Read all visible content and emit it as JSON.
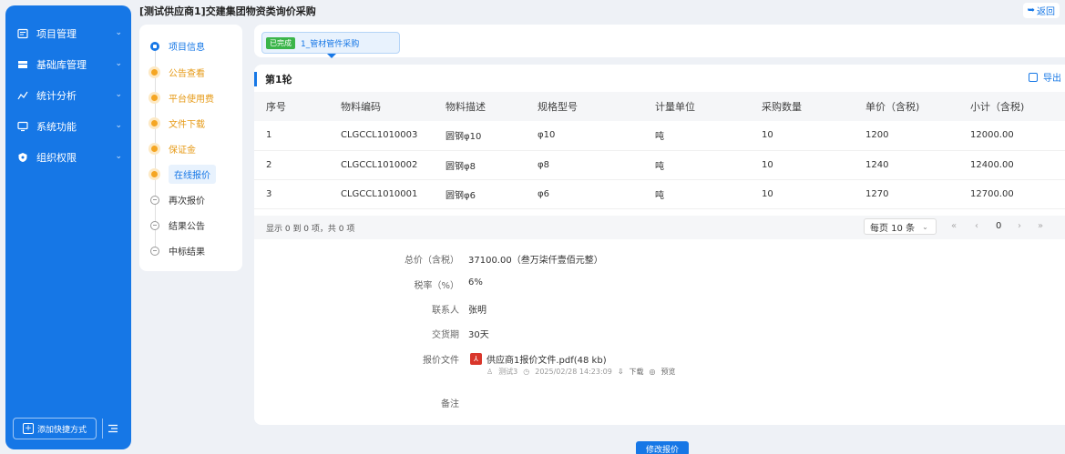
{
  "page": {
    "title": "[测试供应商1]交建集团物资类询价采购",
    "back_label": "返回"
  },
  "sidebar": {
    "items": [
      {
        "label": "项目管理"
      },
      {
        "label": "基础库管理"
      },
      {
        "label": "统计分析"
      },
      {
        "label": "系统功能"
      },
      {
        "label": "组织权限"
      }
    ],
    "add_shortcut_label": "添加快捷方式"
  },
  "steps": [
    {
      "label": "项目信息",
      "state": "info"
    },
    {
      "label": "公告查看",
      "state": "done"
    },
    {
      "label": "平台使用费",
      "state": "done"
    },
    {
      "label": "文件下载",
      "state": "done"
    },
    {
      "label": "保证金",
      "state": "done"
    },
    {
      "label": "在线报价",
      "state": "active"
    },
    {
      "label": "再次报价",
      "state": "todo"
    },
    {
      "label": "结果公告",
      "state": "todo"
    },
    {
      "label": "中标结果",
      "state": "todo"
    }
  ],
  "tab": {
    "status": "已完成",
    "label": "1_管材管件采购"
  },
  "round": {
    "title": "第1轮",
    "export_label": "导出"
  },
  "table": {
    "headers": [
      "序号",
      "物料编码",
      "物料描述",
      "规格型号",
      "计量单位",
      "采购数量",
      "单价（含税)",
      "小计（含税)"
    ],
    "rows": [
      [
        "1",
        "CLGCCL1010003",
        "圆钢φ10",
        "φ10",
        "吨",
        "10",
        "1200",
        "12000.00"
      ],
      [
        "2",
        "CLGCCL1010002",
        "圆钢φ8",
        "φ8",
        "吨",
        "10",
        "1240",
        "12400.00"
      ],
      [
        "3",
        "CLGCCL1010001",
        "圆钢φ6",
        "φ6",
        "吨",
        "10",
        "1270",
        "12700.00"
      ]
    ]
  },
  "pager": {
    "summary": "显示 0 到 0 项，共 0 项",
    "page_size": "每页 10 条",
    "current_page": "0"
  },
  "detail": {
    "total_label": "总价（含税）",
    "total_value": "37100.00（叁万柒仟壹佰元整）",
    "tax_label": "税率（%）",
    "tax_value": "6%",
    "contact_label": "联系人",
    "contact_value": "张明",
    "delivery_label": "交货期",
    "delivery_value": "30天",
    "file_label": "报价文件",
    "file_name": "供应商1报价文件.pdf(48 kb)",
    "file_user": "测试3",
    "file_time": "2025/02/28 14:23:09",
    "download_label": "下载",
    "preview_label": "预览",
    "remark_label": "备注"
  },
  "actions": {
    "modify_label": "修改报价"
  },
  "colors": {
    "accent": "#1677e6",
    "done": "#f5a623",
    "tag_done": "#3bb54a"
  }
}
